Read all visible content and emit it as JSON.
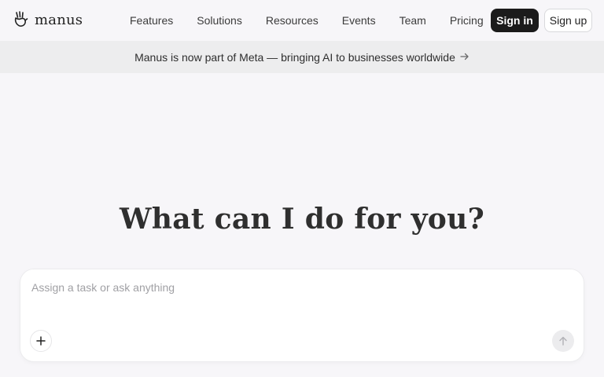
{
  "brand": {
    "name": "manus",
    "logo_icon": "manus-hand-logo-icon"
  },
  "nav": {
    "links": [
      "Features",
      "Solutions",
      "Resources",
      "Events",
      "Team",
      "Pricing"
    ],
    "sign_in": "Sign in",
    "sign_up": "Sign up"
  },
  "banner": {
    "text": "Manus is now part of Meta — bringing AI to businesses worldwide",
    "arrow_icon": "arrow-right-icon"
  },
  "hero": {
    "headline": "What can I do for you?"
  },
  "composer": {
    "placeholder": "Assign a task or ask anything",
    "value": "",
    "add_icon": "plus-icon",
    "send_icon": "arrow-up-icon"
  },
  "colors": {
    "background": "#f7f6f9",
    "banner_bg": "#ededee",
    "primary_button": "#1b1b1b",
    "card_bg": "#ffffff"
  }
}
